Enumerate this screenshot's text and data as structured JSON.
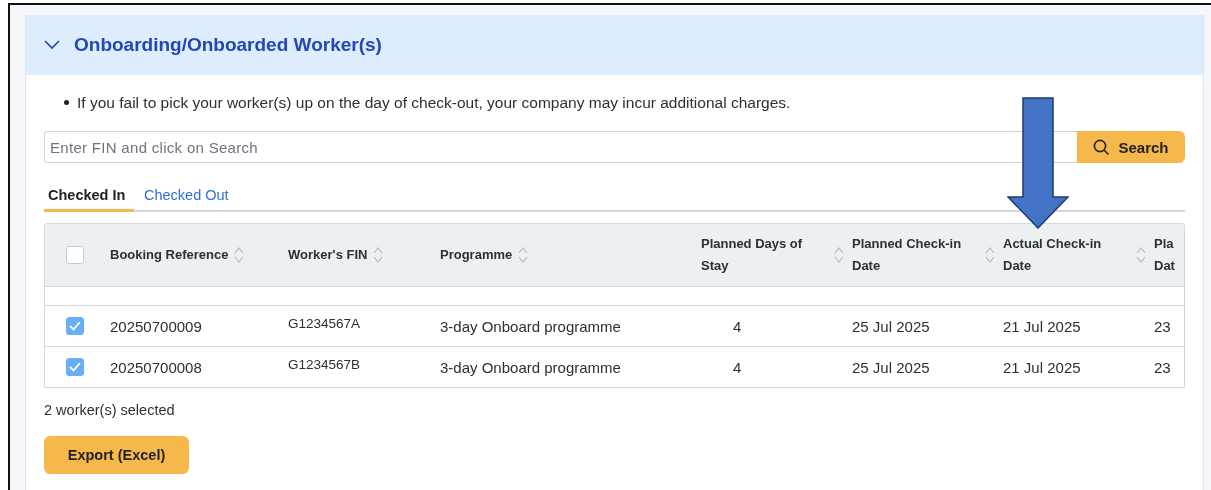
{
  "section": {
    "title": "Onboarding/Onboarded Worker(s)",
    "expanded": true
  },
  "notes": [
    "If you fail to pick your worker(s) up on the day of check-out, your company may incur additional charges."
  ],
  "search": {
    "placeholder": "Enter FIN and click on Search",
    "button": "Search"
  },
  "tabs": [
    {
      "label": "Checked In",
      "selected": true
    },
    {
      "label": "Checked Out",
      "selected": false
    }
  ],
  "table": {
    "all_checked": false,
    "columns": [
      {
        "lines": [
          "Booking Reference"
        ],
        "sortable": true
      },
      {
        "lines": [
          "Worker's FIN"
        ],
        "sortable": true
      },
      {
        "lines": [
          "Programme"
        ],
        "sortable": true
      },
      {
        "lines": [
          "Planned Days of",
          "Stay"
        ],
        "sortable": true
      },
      {
        "lines": [
          "Planned Check-in",
          "Date"
        ],
        "sortable": true
      },
      {
        "lines": [
          "Actual Check-in",
          "Date"
        ],
        "sortable": true
      },
      {
        "lines": [
          "Pla",
          "Dat"
        ],
        "sortable": false
      }
    ],
    "rows": [
      {
        "selected": true,
        "cells": [
          "20250700009",
          "G1234567A",
          "3-day Onboard programme",
          "4",
          "25 Jul 2025",
          "21 Jul 2025",
          "23"
        ]
      },
      {
        "selected": true,
        "cells": [
          "20250700008",
          "G1234567B",
          "3-day Onboard programme",
          "4",
          "25 Jul 2025",
          "21 Jul 2025",
          "23"
        ]
      }
    ]
  },
  "selection_count": "2 worker(s) selected",
  "export_button": "Export (Excel)"
}
